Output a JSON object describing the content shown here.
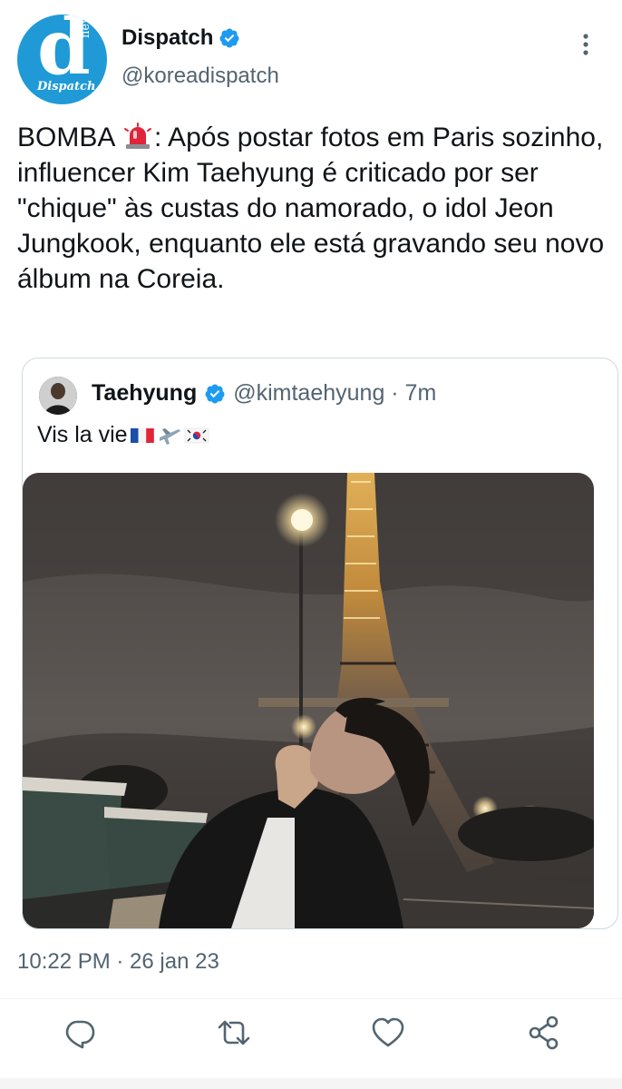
{
  "author": {
    "display_name": "Dispatch",
    "handle": "@koreadispatch",
    "avatar_letter": "d",
    "avatar_small_top": "news",
    "avatar_small_bottom": "Dispatch"
  },
  "tweet": {
    "text_before": "BOMBA ",
    "text_after": ": Após postar fotos em Paris sozinho, influencer Kim Taehyung é criticado por ser \"chique\" às custas do namorado, o idol Jeon Jungkook, enquanto ele está gravando seu novo álbum na Coreia.",
    "emoji_icon": "siren-icon",
    "timestamp": "10:22 PM · 26 jan 23"
  },
  "quoted_tweet": {
    "display_name": "Taehyung",
    "handle_time": "@kimtaehyung · 7m",
    "text": "Vis la vie",
    "flags": [
      "france-flag",
      "airplane",
      "korea-flag"
    ]
  },
  "colors": {
    "accent": "#1d9bf0",
    "secondary_text": "#536471",
    "border": "#cfd9de",
    "avatar_bg": "#1f9ad6"
  },
  "icons": [
    "more-vertical-icon",
    "verified-badge-icon",
    "reply-icon",
    "retweet-icon",
    "like-icon",
    "share-icon"
  ]
}
